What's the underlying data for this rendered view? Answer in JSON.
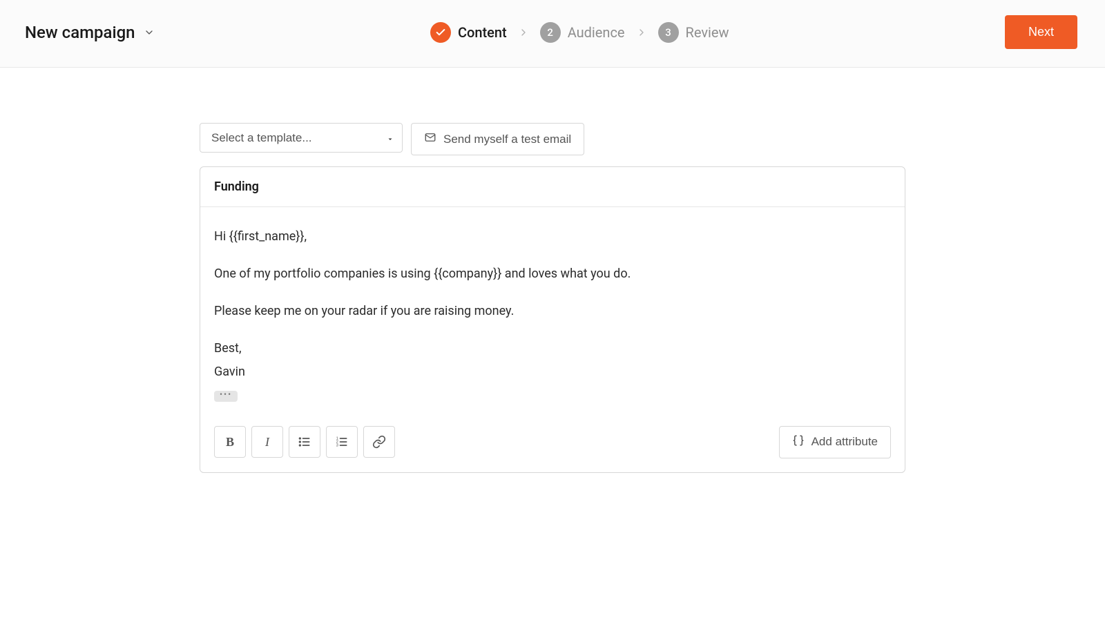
{
  "header": {
    "title": "New campaign",
    "steps": [
      {
        "label": "Content",
        "state": "done"
      },
      {
        "label": "Audience",
        "number": "2",
        "state": "pending"
      },
      {
        "label": "Review",
        "number": "3",
        "state": "pending"
      }
    ],
    "next_label": "Next"
  },
  "actions": {
    "template_placeholder": "Select a template...",
    "test_email_label": "Send myself a test email"
  },
  "editor": {
    "subject": "Funding",
    "body": {
      "greeting": "Hi {{first_name}},",
      "line1": "One of my portfolio companies is using {{company}} and loves what you do.",
      "line2": "Please keep me on your radar if you are raising money.",
      "signoff": "Best,",
      "signature_name": "Gavin"
    }
  },
  "toolbar": {
    "bold": "B",
    "italic": "I",
    "add_attribute_label": "Add attribute"
  }
}
